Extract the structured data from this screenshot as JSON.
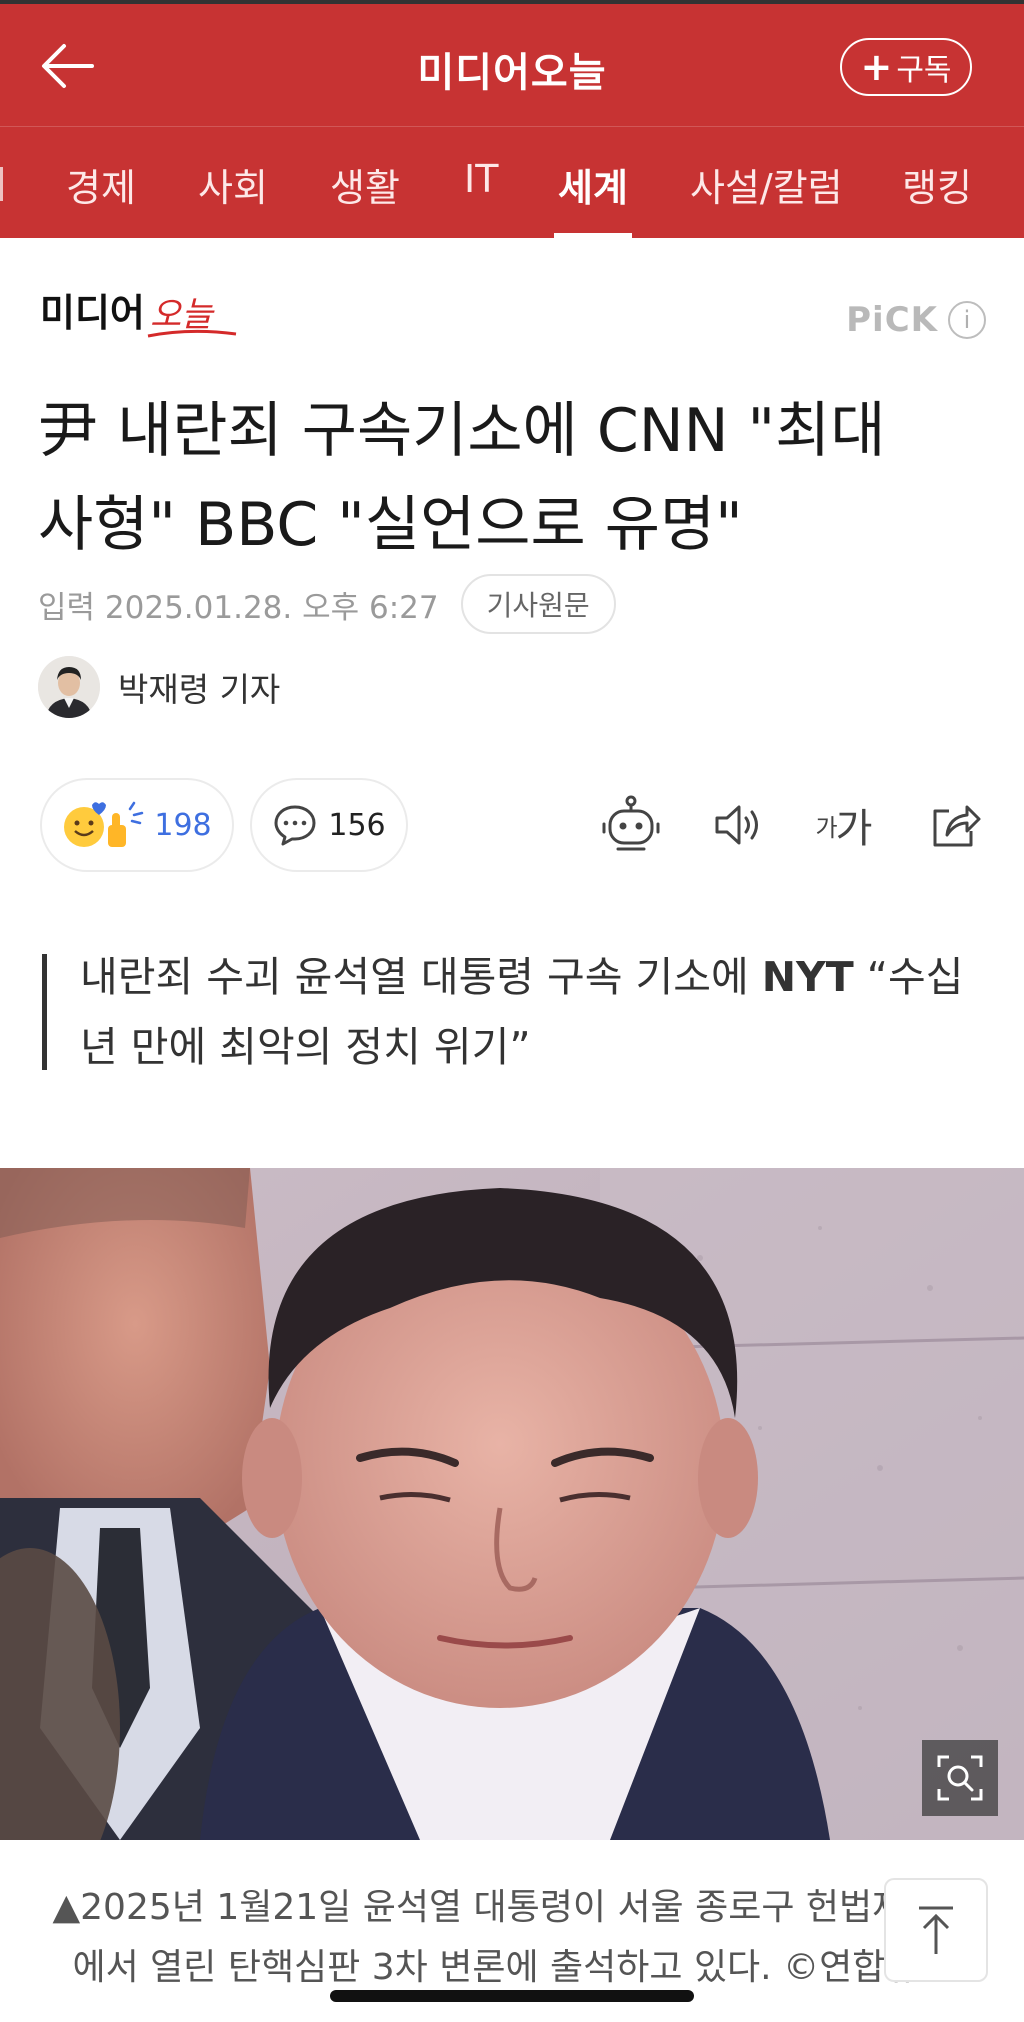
{
  "colors": {
    "brand": "#c73333",
    "reaction_count": "#3e6fe0",
    "muted": "#9a9a9a"
  },
  "header": {
    "title": "미디어오늘",
    "subscribe_label": "구독",
    "back_icon": "arrow-left-icon"
  },
  "tabs": [
    {
      "label": "경제",
      "active": false
    },
    {
      "label": "사회",
      "active": false
    },
    {
      "label": "생활",
      "active": false
    },
    {
      "label": "IT",
      "active": false
    },
    {
      "label": "세계",
      "active": true
    },
    {
      "label": "사설/칼럼",
      "active": false
    },
    {
      "label": "랭킹",
      "active": false
    }
  ],
  "press": {
    "logo_text": "미디어오늘",
    "pick_label": "PiCK",
    "info_icon": "i"
  },
  "article": {
    "headline_line1": "尹 내란죄 구속기소에 CNN \"최대",
    "headline_line2": "사형\" BBC \"실언으로 유명\"",
    "date": "입력 2025.01.28. 오후 6:27",
    "original_label": "기사원문",
    "reporter": "박재령 기자",
    "subtitle_part1": "내란죄 수괴 윤석열 대통령 구속 기소에 ",
    "subtitle_bold": "NYT",
    "subtitle_part2": " “수십 년 만에 최악의 정치 위기”",
    "caption_line1": "▲2025년 1월21일 윤석열 대통령이 서울 종로구 헌법재판소",
    "caption_line2": "에서 열린 탄핵심판 3차 변론에 출석하고 있다. ©연합뉴스"
  },
  "actions": {
    "reaction_count": "198",
    "comment_count": "156",
    "font_size_label_small": "가",
    "font_size_label_large": "가"
  }
}
